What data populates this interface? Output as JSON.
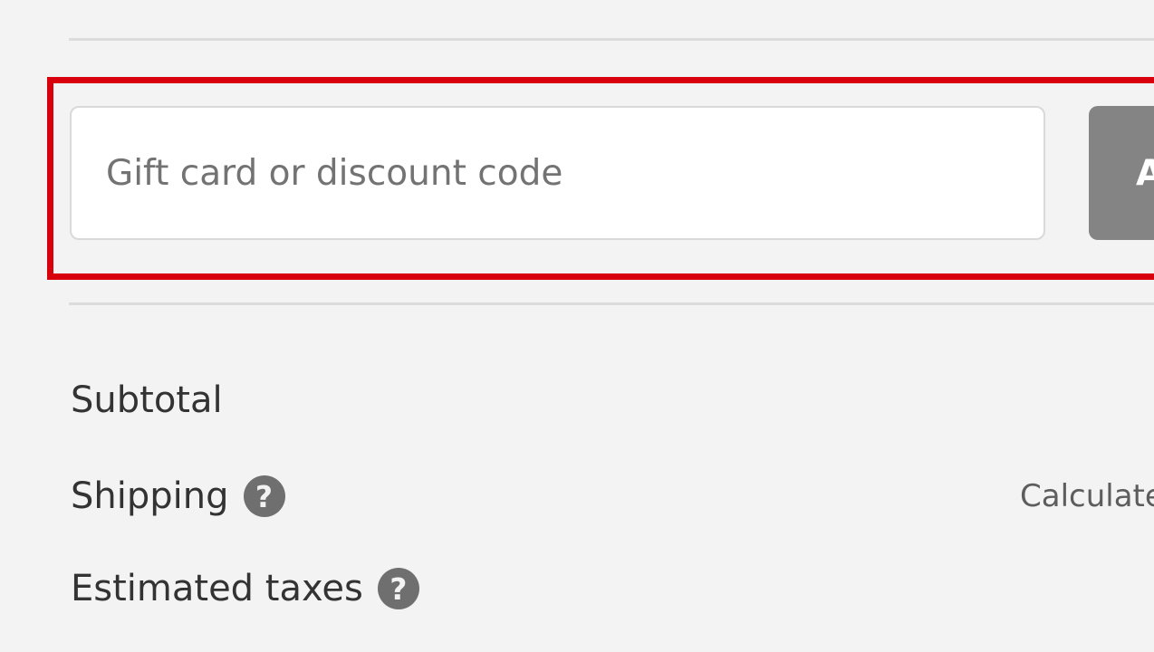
{
  "discount": {
    "placeholder": "Gift card or discount code",
    "apply_label": "Apply"
  },
  "summary": {
    "subtotal_label": "Subtotal",
    "subtotal_value": "",
    "shipping_label": "Shipping",
    "shipping_value": "Calculated at next step",
    "taxes_label": "Estimated taxes",
    "taxes_value": ""
  },
  "icons": {
    "help": "question-circle-icon"
  },
  "colors": {
    "highlight": "#d9000d",
    "apply_button": "#848484",
    "background": "#f3f3f3"
  }
}
